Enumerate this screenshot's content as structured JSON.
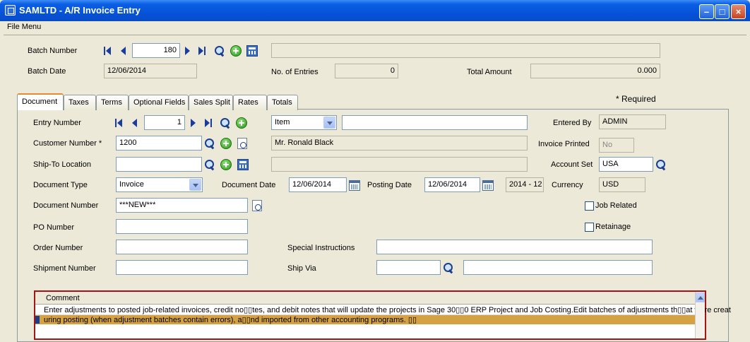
{
  "window": {
    "title": "SAMLTD - A/R Invoice Entry"
  },
  "menu": {
    "file": "File Menu"
  },
  "batch": {
    "number_label": "Batch Number",
    "number_value": "180",
    "description_value": "",
    "date_label": "Batch Date",
    "date_value": "12/06/2014",
    "entries_label": "No. of Entries",
    "entries_value": "0",
    "total_label": "Total Amount",
    "total_value": "0.000"
  },
  "required_note": "*  Required",
  "tabs": [
    {
      "label": "Document"
    },
    {
      "label": "Taxes"
    },
    {
      "label": "Terms"
    },
    {
      "label": "Optional Fields"
    },
    {
      "label": "Sales Split"
    },
    {
      "label": "Rates"
    },
    {
      "label": "Totals"
    }
  ],
  "document": {
    "entry_number_label": "Entry Number",
    "entry_number_value": "1",
    "entry_type_value": "Item",
    "entry_desc_value": "",
    "entered_by_label": "Entered By",
    "entered_by_value": "ADMIN",
    "customer_number_label": "Customer Number *",
    "customer_number_value": "1200",
    "customer_name_value": "Mr. Ronald Black",
    "invoice_printed_label": "Invoice Printed",
    "invoice_printed_value": "No",
    "ship_to_label": "Ship-To Location",
    "ship_to_value": "",
    "ship_to_desc_value": "",
    "account_set_label": "Account Set",
    "account_set_value": "USA",
    "doc_type_label": "Document Type",
    "doc_type_value": "Invoice",
    "doc_date_label": "Document Date",
    "doc_date_value": "12/06/2014",
    "posting_date_label": "Posting Date",
    "posting_date_value": "12/06/2014",
    "period_value": "2014 - 12",
    "currency_label": "Currency",
    "currency_value": "USD",
    "doc_number_label": "Document Number",
    "doc_number_value": "***NEW***",
    "job_related_label": "Job Related",
    "po_number_label": "PO Number",
    "retainage_label": "Retainage",
    "order_number_label": "Order Number",
    "special_instr_label": "Special Instructions",
    "shipment_number_label": "Shipment Number",
    "ship_via_label": "Ship Via"
  },
  "comment_grid": {
    "header": "Comment",
    "rows": [
      "Enter adjustments to posted job-related invoices, credit no▯▯tes, and debit notes that will update the projects in Sage 30▯▯0 ERP Project and Job Costing.Edit batches of adjustments th▯▯at were creat",
      "uring posting (when adjustment batches contain errors), a▯▯nd imported from other accounting programs. ▯▯"
    ]
  },
  "colors": {
    "titlebar": "#0551d6",
    "window_bg": "#ece9d8",
    "selected_row": "#d4a244",
    "grid_border": "#a31515"
  }
}
